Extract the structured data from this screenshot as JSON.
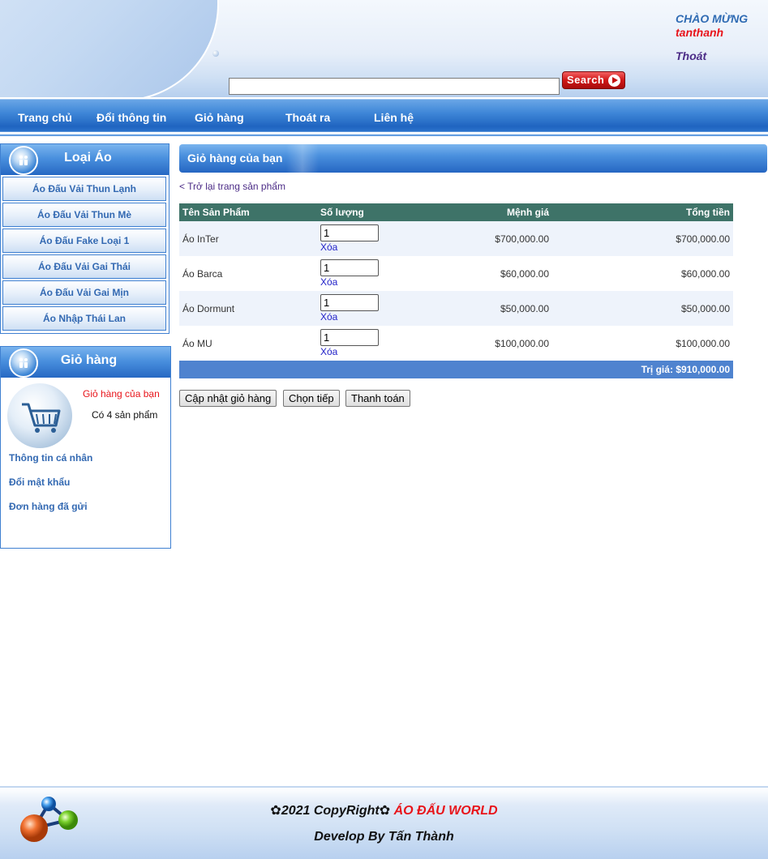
{
  "header": {
    "welcome": "CHÀO MỪNG",
    "username": "tanthanh",
    "logout": "Thoát",
    "search_value": "",
    "search_button": "Search"
  },
  "nav": {
    "items": [
      "Trang chủ",
      "Đổi thông tin",
      "Giỏ hàng",
      "Thoát ra",
      "Liên hệ"
    ]
  },
  "sidebar": {
    "categories_title": "Loại Áo",
    "categories": [
      "Áo Đấu Vải Thun Lạnh",
      "Áo Đấu Vải Thun Mè",
      "Áo Đấu Fake Loại 1",
      "Áo Đấu Vải Gai Thái",
      "Áo Đấu Vải Gai Mịn",
      "Áo Nhập Thái Lan"
    ],
    "cart_title": "Giỏ hàng",
    "cart_link": "Giỏ hàng của bạn",
    "cart_count": "Có 4 sản phẩm",
    "links": [
      "Thông tin cá nhân",
      "Đổi mật khẩu",
      "Đơn hàng đã gửi"
    ]
  },
  "main": {
    "title": "Giỏ hàng của bạn",
    "back_link": "< Trở lại trang sản phẩm",
    "table": {
      "headers": [
        "Tên Sản Phẩm",
        "Số lượng",
        "Mệnh giá",
        "Tổng tiền"
      ],
      "rows": [
        {
          "name": "Áo InTer",
          "qty": "1",
          "delete": "Xóa",
          "price": "$700,000.00",
          "total": "$700,000.00"
        },
        {
          "name": "Áo Barca",
          "qty": "1",
          "delete": "Xóa",
          "price": "$60,000.00",
          "total": "$60,000.00"
        },
        {
          "name": "Áo Dormunt",
          "qty": "1",
          "delete": "Xóa",
          "price": "$50,000.00",
          "total": "$50,000.00"
        },
        {
          "name": "Áo MU",
          "qty": "1",
          "delete": "Xóa",
          "price": "$100,000.00",
          "total": "$100,000.00"
        }
      ],
      "grand_total": "Trị giá: $910,000.00"
    },
    "buttons": {
      "update": "Cập nhật giỏ hàng",
      "continue": "Chọn tiếp",
      "checkout": "Thanh toán"
    }
  },
  "footer": {
    "copyright": "✿2021 CopyRight✿",
    "brand": "ÁO ĐẤU WORLD",
    "developer": "Develop By Tấn Thành"
  }
}
